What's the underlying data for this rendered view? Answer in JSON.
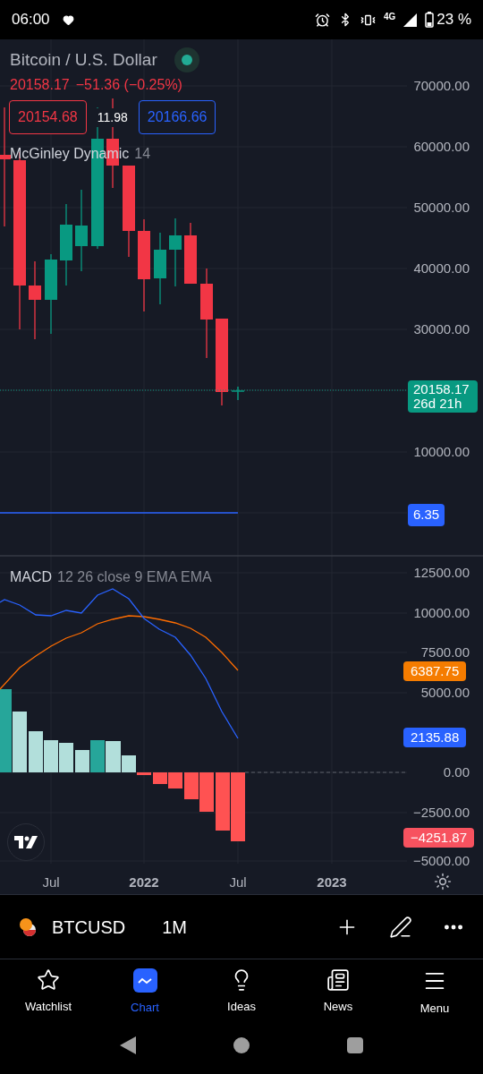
{
  "status_bar": {
    "time": "06:00",
    "network": "4G",
    "battery": "23 %"
  },
  "chart": {
    "title": "Bitcoin / U.S. Dollar",
    "live": true,
    "last": "20158.17",
    "change": "−51.36 (−0.25%)",
    "bid": "20154.68",
    "spread": "11.98",
    "ask": "20166.66",
    "indicator": {
      "name": "McGinley Dynamic",
      "params": "14"
    },
    "price_axis": [
      "70000.00",
      "60000.00",
      "50000.00",
      "40000.00",
      "30000.00",
      "10000.00"
    ],
    "last_price_label": {
      "price": "20158.17",
      "countdown": "26d 21h"
    },
    "indicator_label": "6.35"
  },
  "macd": {
    "name": "MACD",
    "params": "12 26 close 9 EMA EMA",
    "axis": [
      "12500.00",
      "10000.00",
      "7500.00",
      "5000.00",
      "0.00",
      "−2500.00",
      "−5000.00"
    ],
    "labels": [
      {
        "kind": "signal",
        "text": "6387.75"
      },
      {
        "kind": "macd",
        "text": "2135.88"
      },
      {
        "kind": "histogram",
        "text": "−4251.87"
      }
    ]
  },
  "time_axis": [
    {
      "label": "Jul",
      "bold": false
    },
    {
      "label": "2022",
      "bold": true
    },
    {
      "label": "Jul",
      "bold": false
    },
    {
      "label": "2023",
      "bold": true
    }
  ],
  "toolbar": {
    "symbol": "BTCUSD",
    "interval": "1M"
  },
  "nav": [
    {
      "label": "Watchlist",
      "selected": false
    },
    {
      "label": "Chart",
      "selected": true
    },
    {
      "label": "Ideas",
      "selected": false
    },
    {
      "label": "News",
      "selected": false
    },
    {
      "label": "Menu",
      "selected": false
    }
  ]
}
